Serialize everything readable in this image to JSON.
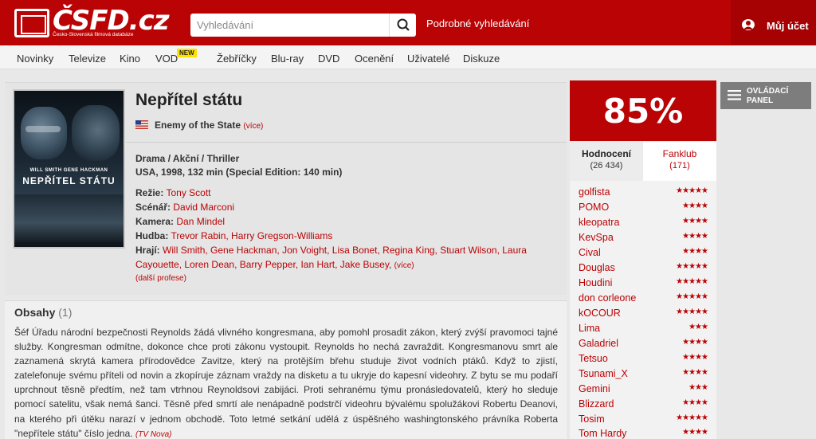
{
  "header": {
    "logo_text": "ČSFD.cz",
    "logo_tagline": "Česko-Slovenská filmová databáze",
    "search_placeholder": "Vyhledávání",
    "advanced_search": "Podrobné vyhledávání",
    "account_label": "Můj účet",
    "brand_color": "#ba0305"
  },
  "nav": {
    "items": [
      "Novinky",
      "Televize",
      "Kino",
      "VOD",
      "Žebříčky",
      "Blu-ray",
      "DVD",
      "Ocenění",
      "Uživatelé",
      "Diskuze"
    ],
    "vod_badge": "NEW"
  },
  "film": {
    "title": "Nepřítel státu",
    "original_title": "Enemy of the State",
    "original_more": "(více)",
    "genres": "Drama / Akční / Thriller",
    "origin": "USA, 1998, 132 min (Special Edition: 140 min)",
    "poster_cast": "WILL SMITH  GENE HACKMAN",
    "poster_title": "NEPŘÍTEL STÁTU",
    "crew": {
      "directing_label": "Režie:",
      "directing": "Tony Scott",
      "screenplay_label": "Scénář:",
      "screenplay": "David Marconi",
      "camera_label": "Kamera:",
      "camera": "Dan Mindel",
      "music_label": "Hudba:",
      "music": "Trevor Rabin, Harry Gregson-Williams"
    },
    "cast_label": "Hrají:",
    "cast": "Will Smith, Gene Hackman, Jon Voight, Lisa Bonet, Regina King, Stuart Wilson, Laura Cayouette, Loren Dean, Barry Pepper, Ian Hart, Jake Busey",
    "cast_more": "(více)",
    "more_professions": "(další profese)"
  },
  "plot": {
    "heading": "Obsahy",
    "count": "(1)",
    "text": "Šéf Úřadu národní bezpečnosti Reynolds žádá vlivného kongresmana, aby pomohl prosadit zákon, který zvýší pravomoci tajné služby. Kongresman odmítne, dokonce chce proti zákonu vystoupit. Reynolds ho nechá zavraždit. Kongresmanovu smrt ale zaznamená skrytá kamera přírodovědce Zavitze, který na protějším břehu studuje život vodních ptáků. Když to zjistí, zatelefonuje svému příteli od novin a zkopíruje záznam vraždy na disketu a tu ukryje do kapesní videohry. Z bytu se mu podaří uprchnout těsně předtím, než tam vtrhnou Reynoldsovi zabijáci. Proti sehranému týmu pronásledovatelů, který ho sleduje pomocí satelitu, však nemá šanci. Těsně před smrtí ale nenápadně podstrčí videohru bývalému spolužákovi Robertu Deanovi, na kterého při útěku narazí v jednom obchodě. Toto letmé setkání udělá z úspěšného washingtonského právníka Roberta \"nepřítele státu\" číslo jedna.",
    "source": "(TV Nova)"
  },
  "rating": {
    "value": "85%",
    "tab_ratings_label": "Hodnocení",
    "tab_ratings_count": "(26 434)",
    "tab_fans_label": "Fanklub",
    "tab_fans_count": "(171)",
    "users": [
      {
        "name": "golfista",
        "stars": 5
      },
      {
        "name": "POMO",
        "stars": 4
      },
      {
        "name": "kleopatra",
        "stars": 4
      },
      {
        "name": "KevSpa",
        "stars": 4
      },
      {
        "name": "Cival",
        "stars": 4
      },
      {
        "name": "Douglas",
        "stars": 5
      },
      {
        "name": "Houdini",
        "stars": 5
      },
      {
        "name": "don corleone",
        "stars": 5
      },
      {
        "name": "kOCOUR",
        "stars": 5
      },
      {
        "name": "Lima",
        "stars": 3
      },
      {
        "name": "Galadriel",
        "stars": 4
      },
      {
        "name": "Tetsuo",
        "stars": 4
      },
      {
        "name": "Tsunami_X",
        "stars": 4
      },
      {
        "name": "Gemini",
        "stars": 3
      },
      {
        "name": "Blizzard",
        "stars": 4
      },
      {
        "name": "Tosim",
        "stars": 5
      },
      {
        "name": "Tom Hardy",
        "stars": 4
      }
    ]
  },
  "panel": {
    "label_line1": "OVLÁDACÍ",
    "label_line2": "PANEL"
  }
}
